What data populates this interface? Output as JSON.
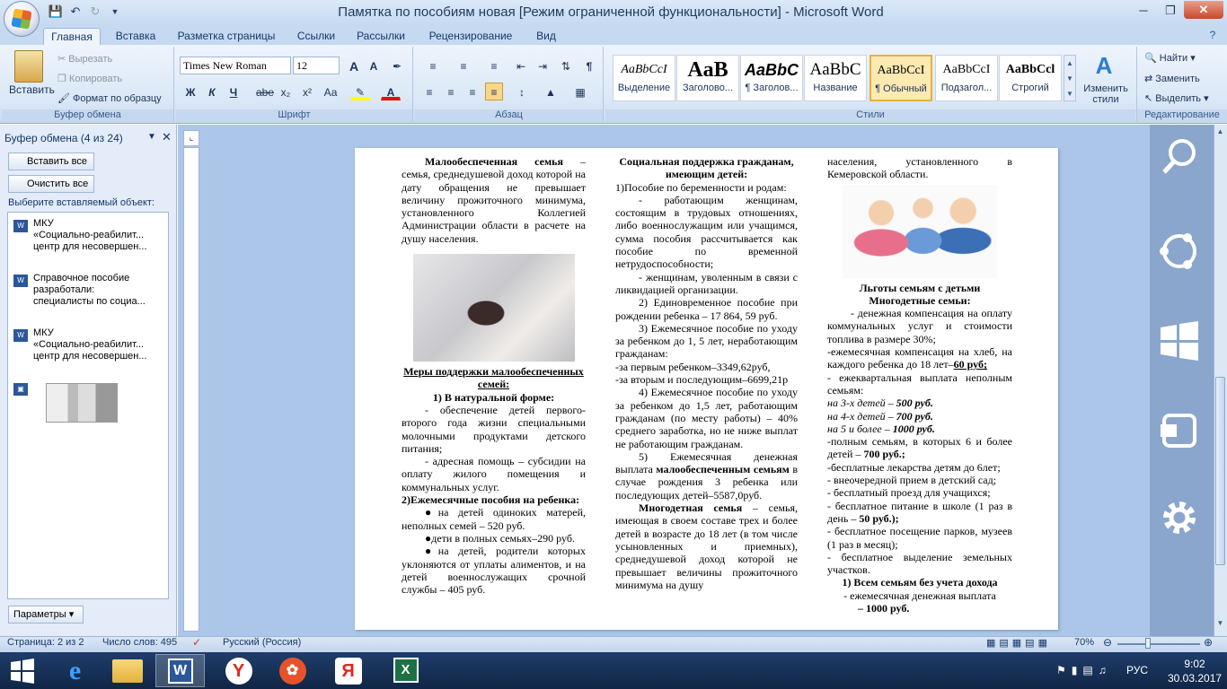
{
  "window": {
    "title": "Памятка по  пособиям новая [Режим ограниченной функциональности] - Microsoft Word"
  },
  "qat": {
    "save_icon": "save-icon",
    "undo_icon": "undo-icon",
    "redo_icon": "redo-icon"
  },
  "tabs": [
    "Главная",
    "Вставка",
    "Разметка страницы",
    "Ссылки",
    "Рассылки",
    "Рецензирование",
    "Вид"
  ],
  "ribbon": {
    "clipboard": {
      "paste": "Вставить",
      "cut": "Вырезать",
      "copy": "Копировать",
      "format_painter": "Формат по образцу",
      "label": "Буфер обмена"
    },
    "font": {
      "name": "Times New Roman",
      "size": "12",
      "label": "Шрифт",
      "bold": "Ж",
      "italic": "К",
      "underline": "Ч",
      "strike": "abe",
      "sub": "x₂",
      "sup": "x²",
      "case": "Аа",
      "grow": "A",
      "shrink": "A"
    },
    "paragraph": {
      "label": "Абзац"
    },
    "styles": {
      "label": "Стили",
      "items": [
        {
          "preview": "AaBbCcI",
          "name": "Выделение"
        },
        {
          "preview": "AaB",
          "name": "Заголово..."
        },
        {
          "preview": "AaBbC",
          "name": "¶ Заголов..."
        },
        {
          "preview": "AaBbC",
          "name": "Название"
        },
        {
          "preview": "AaBbCcI",
          "name": "¶ Обычный"
        },
        {
          "preview": "AaBbCcI",
          "name": "Подзагол..."
        },
        {
          "preview": "AaBbCcl",
          "name": "Строгий"
        }
      ],
      "change": "Изменить стили"
    },
    "editing": {
      "find": "Найти",
      "replace": "Заменить",
      "select": "Выделить",
      "label": "Редактирование"
    }
  },
  "clip_panel": {
    "title": "Буфер обмена (4 из 24)",
    "paste_all": "Вставить все",
    "clear_all": "Очистить все",
    "hint": "Выберите вставляемый объект:",
    "items": [
      {
        "l1": "МКУ",
        "l2": "«Социально-реабилит...",
        "l3": "центр для несовершен..."
      },
      {
        "l1": "Справочное пособие",
        "l2": "разработали:",
        "l3": "специалисты по социа..."
      },
      {
        "l1": "МКУ",
        "l2": "«Социально-реабилит...",
        "l3": "центр для несовершен..."
      }
    ],
    "options": "Параметры"
  },
  "doc": {
    "col1": {
      "p1_bold": "Малообеспеченная семья",
      "p1": " – семья, среднедушевой доход которой на дату обращения не превышает величину прожиточного минимума, установленного Коллегией Администрации области в расчете на душу населения.",
      "h1": "Меры поддержки малообеспеченных семей:",
      "h2": "1) В натуральной форме:",
      "p2": "- обеспечение детей первого-второго года жизни специальными молочными продуктами детского питания;",
      "p3": "- адресная помощь – субсидии на оплату жилого помещения и коммунальных услуг.",
      "h3": "2)Ежемесячные пособия на ребенка:",
      "b1": "●на детей одиноких матерей, неполных семей – 520 руб.",
      "b2": "●дети в полных семьях–290 руб.",
      "b3": "●на детей, родители которых уклоняются от уплаты алиментов, и на детей военнослужащих срочной службы – 405 руб."
    },
    "col2": {
      "h1": "Социальная поддержка гражданам, имеющим детей:",
      "p1": "1)Пособие по беременности и родам:",
      "p2": "- работающим женщинам, состоящим в трудовых отношениях, либо военнослужащим или учащимся, сумма пособия рассчитывается как пособие по временной нетрудоспособности;",
      "p3": "- женщинам, уволенным в связи с ликвидацией организации.",
      "p4": "2) Единовременное пособие при рождении ребенка – 17 864, 59 руб.",
      "p5": "3) Ежемесячное пособие по уходу за ребенком до 1, 5 лет, неработающим гражданам:",
      "p6": "-за первым ребенком–3349,62руб,",
      "p7": "-за вторым и последующим–6699,21р",
      "p8": "4) Ежемесячное пособие по уходу за ребенком до 1,5 лет, работающим гражданам (по месту работы) – 40% среднего заработка, но не ниже выплат не работающим гражданам.",
      "p9a": "5) Ежемесячная денежная выплата ",
      "p9b": "малообеспеченным семьям",
      "p9c": " в случае рождения 3 ребенка или последующих детей–5587,0руб.",
      "p10_bold": "Многодетная семья",
      "p10": " – семья, имеющая в своем составе трех и более детей в возрасте до 18 лет (в том числе усыновленных и приемных), среднедушевой доход которой не превышает величины прожиточного минимума на душу"
    },
    "col3": {
      "p0": "населения, установленного в Кемеровской области.",
      "h1": "Льготы семьям с детьми",
      "h2": "Многодетные семьи:",
      "p1": "- денежная компенсация на оплату коммунальных услуг и стоимости топлива в размере 30%;",
      "p2a": "-ежемесячная компенсация на хлеб, на каждого ребенка до 18 лет–",
      "p2b": "60 руб;",
      "p3": "- ежеквартальная выплата неполным семьям:",
      "p4a": "на 3-х детей – ",
      "p4b": "500 руб.",
      "p5a": "на 4-х детей – ",
      "p5b": "700 руб.",
      "p6a": "на 5 и более – ",
      "p6b": "1000 руб.",
      "p7a": "-полным семьям, в которых 6 и более детей – ",
      "p7b": "700 руб.;",
      "p8": "-бесплатные лекарства детям до 6лет;",
      "p9": "- внеочередной прием в детский сад;",
      "p10": "- бесплатный проезд для учащихся;",
      "p11a": "- бесплатное питание в школе (1 раз в день – ",
      "p11b": "50 руб.);",
      "p12": "- бесплатное посещение парков, музеев (1 раз в месяц);",
      "p13": "- бесплатное выделение земельных участков.",
      "h3": "1) Всем семьям без учета дохода",
      "p14": "- ежемесячная денежная выплата",
      "p15": "– 1000 руб."
    }
  },
  "status": {
    "page": "Страница: 2 из 2",
    "words": "Число слов: 495",
    "lang": "Русский (Россия)",
    "zoom": "70%"
  },
  "tray": {
    "lang": "РУС",
    "time": "9:02",
    "date": "30.03.2017"
  },
  "colors": {
    "accent": "#2b579a",
    "titlebar": "#c5d9f1",
    "docbg": "#abc6e8"
  }
}
